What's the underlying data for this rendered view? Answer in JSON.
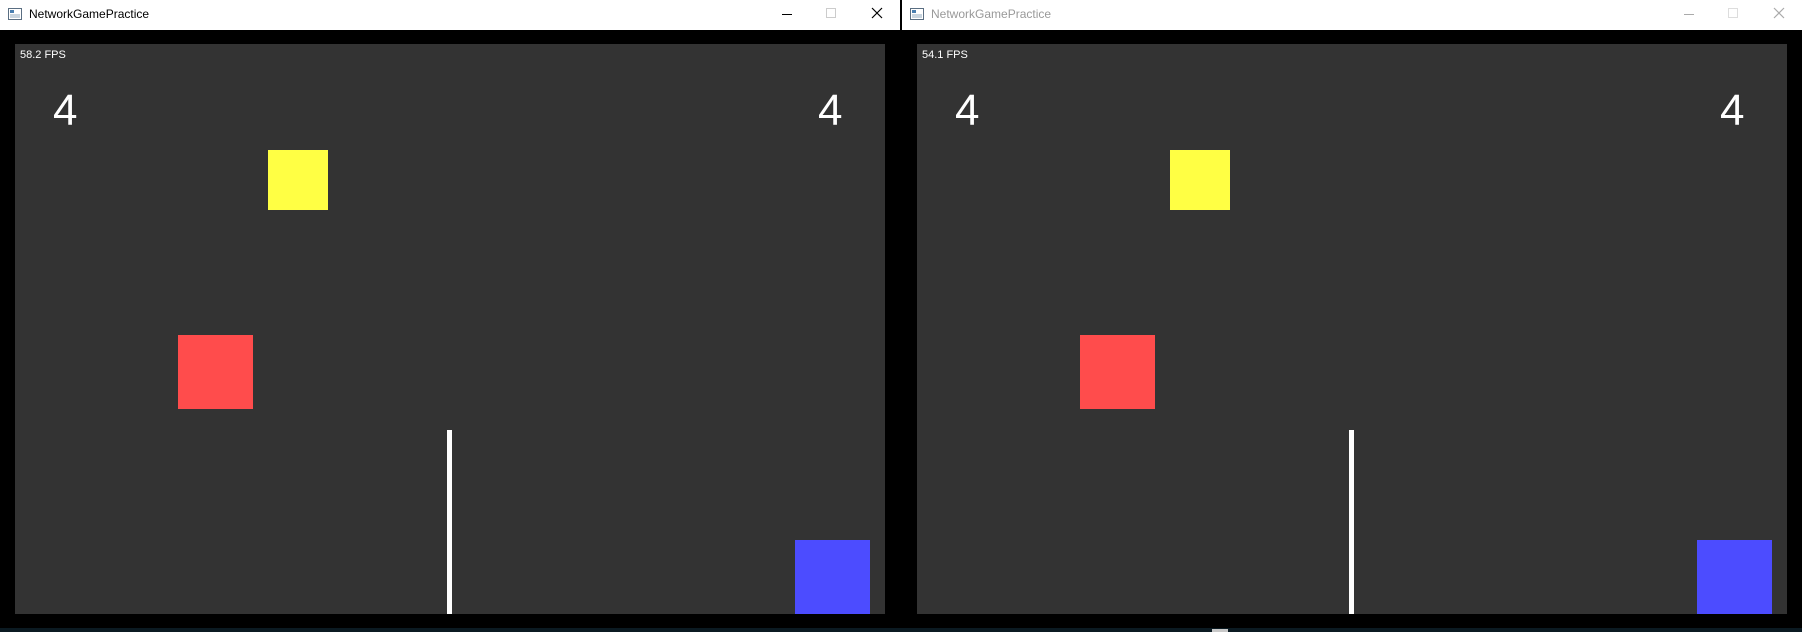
{
  "windows": [
    {
      "title": "NetworkGamePractice",
      "active": true,
      "fps": "58.2 FPS",
      "score_left": "4",
      "score_right": "4"
    },
    {
      "title": "NetworkGamePractice",
      "active": false,
      "fps": "54.1 FPS",
      "score_left": "4",
      "score_right": "4"
    }
  ],
  "colors": {
    "background": "#333333",
    "yellow_block": "#ffff44",
    "red_block": "#ff4c4c",
    "blue_block": "#4c4cff",
    "net": "#ffffff"
  },
  "icons": {
    "app": "app-window-icon",
    "minimize": "minimize-icon",
    "maximize": "maximize-icon",
    "close": "close-icon"
  }
}
